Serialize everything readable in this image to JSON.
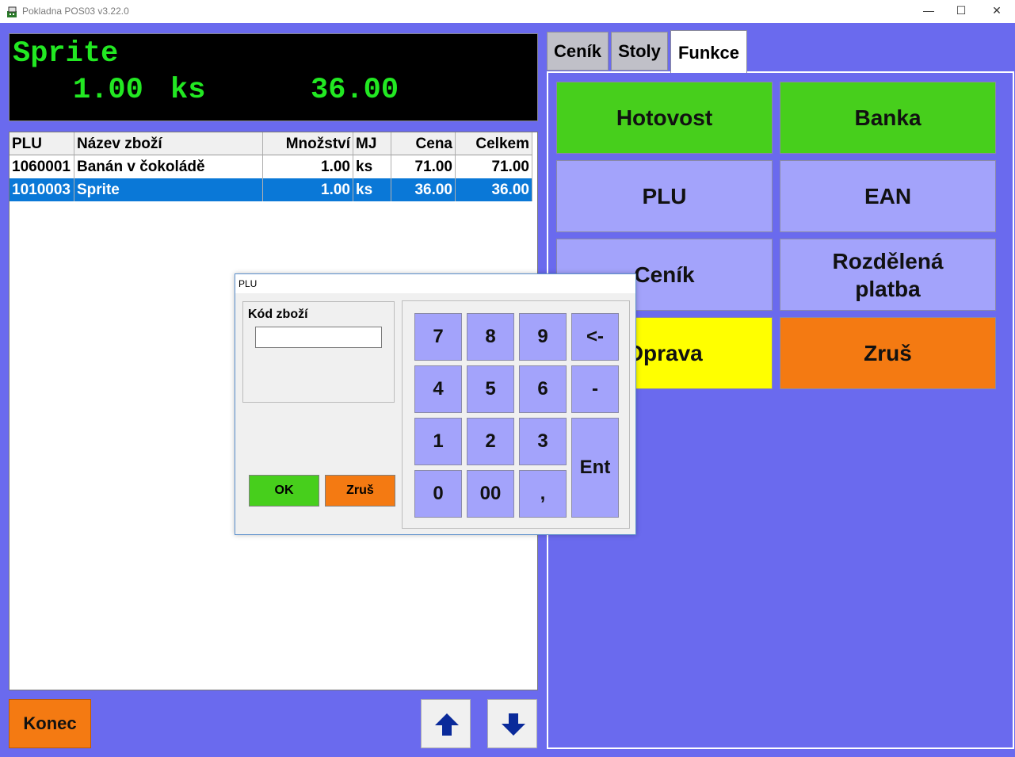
{
  "window": {
    "title": "Pokladna POS03 v3.22.0",
    "minimize_glyph": "—",
    "maximize_glyph": "☐",
    "close_glyph": "✕"
  },
  "display": {
    "name": "Sprite",
    "qty": "1.00",
    "unit": "ks",
    "price": "36.00"
  },
  "table": {
    "headers": {
      "plu": "PLU",
      "name": "Název zboží",
      "qty": "Množství",
      "mj": "MJ",
      "cena": "Cena",
      "celkem": "Celkem"
    },
    "rows": [
      {
        "plu": "1060001",
        "name": "Banán v čokoládě",
        "qty": "1.00",
        "mj": "ks",
        "cena": "71.00",
        "celkem": "71.00",
        "selected": false
      },
      {
        "plu": "1010003",
        "name": "Sprite",
        "qty": "1.00",
        "mj": "ks",
        "cena": "36.00",
        "celkem": "36.00",
        "selected": true
      }
    ]
  },
  "bottom": {
    "konec_label": "Konec",
    "up_icon": "arrow-up-icon",
    "down_icon": "arrow-down-icon"
  },
  "tabs": {
    "cenik": "Ceník",
    "stoly": "Stoly",
    "funkce": "Funkce",
    "active": "funkce"
  },
  "functions": {
    "hotovost": "Hotovost",
    "banka": "Banka",
    "plu": "PLU",
    "ean": "EAN",
    "cenik": "Ceník",
    "rozdelena": "Rozdělená platba",
    "oprava": "Oprava",
    "zrus": "Zruš"
  },
  "dialog": {
    "title": "PLU",
    "field_label": "Kód zboží",
    "field_value": "",
    "ok_label": "OK",
    "cancel_label": "Zruš",
    "keys": {
      "k7": "7",
      "k8": "8",
      "k9": "9",
      "back": "<-",
      "k4": "4",
      "k5": "5",
      "k6": "6",
      "minus": "-",
      "k1": "1",
      "k2": "2",
      "k3": "3",
      "ent": "Ent",
      "k0": "0",
      "k00": "00",
      "comma": ","
    }
  },
  "colors": {
    "background": "#6a6aee",
    "display_text": "#22e822",
    "selected_row": "#0a78d7",
    "green": "#47cf1c",
    "lavender": "#a3a3fb",
    "yellow": "#ffff00",
    "orange": "#f47a12"
  }
}
